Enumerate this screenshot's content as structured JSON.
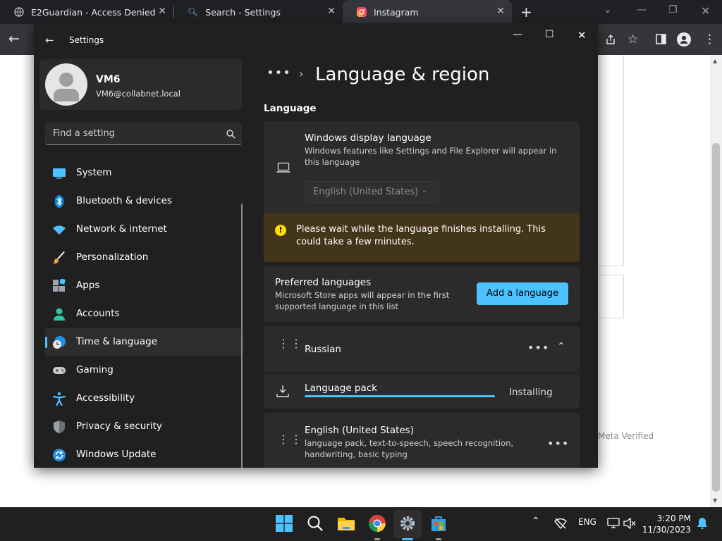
{
  "browser": {
    "tabs": [
      {
        "title": "E2Guardian - Access Denied",
        "icon": "globe-icon"
      },
      {
        "title": "Search - Settings",
        "icon": "search-icon"
      },
      {
        "title": "Instagram",
        "icon": "instagram-icon"
      }
    ]
  },
  "webpage": {
    "meta_text": "Meta Verified"
  },
  "settings": {
    "app_title": "Settings",
    "user": {
      "name": "VM6",
      "email": "VM6@collabnet.local"
    },
    "search_placeholder": "Find a setting",
    "nav": [
      {
        "label": "System",
        "icon": "system-icon"
      },
      {
        "label": "Bluetooth & devices",
        "icon": "bluetooth-icon"
      },
      {
        "label": "Network & internet",
        "icon": "wifi-icon"
      },
      {
        "label": "Personalization",
        "icon": "brush-icon"
      },
      {
        "label": "Apps",
        "icon": "apps-icon"
      },
      {
        "label": "Accounts",
        "icon": "person-icon"
      },
      {
        "label": "Time & language",
        "icon": "clock-globe-icon",
        "selected": true
      },
      {
        "label": "Gaming",
        "icon": "gamepad-icon"
      },
      {
        "label": "Accessibility",
        "icon": "accessibility-icon"
      },
      {
        "label": "Privacy & security",
        "icon": "shield-icon"
      },
      {
        "label": "Windows Update",
        "icon": "update-icon"
      }
    ],
    "page": {
      "breadcrumb_more": "•••",
      "title": "Language & region",
      "section_language": "Language",
      "display_language": {
        "title": "Windows display language",
        "desc": "Windows features like Settings and File Explorer will appear in this language",
        "selected": "English (United States)"
      },
      "warning": "Please wait while the language finishes installing. This could take a few minutes.",
      "preferred": {
        "title": "Preferred languages",
        "desc": "Microsoft Store apps will appear in the first supported language in this list",
        "button": "Add a language"
      },
      "languages": [
        {
          "name": "Russian",
          "expanded": true,
          "pack_label": "Language pack",
          "pack_status": "Installing"
        },
        {
          "name": "English (United States)",
          "features": "language pack, text-to-speech, speech recognition, handwriting, basic typing"
        }
      ]
    }
  },
  "taskbar": {
    "input_lang": "ENG",
    "time": "3:20 PM",
    "date": "11/30/2023"
  },
  "colors": {
    "accent": "#4cc2ff",
    "warning_bg": "#433519"
  }
}
